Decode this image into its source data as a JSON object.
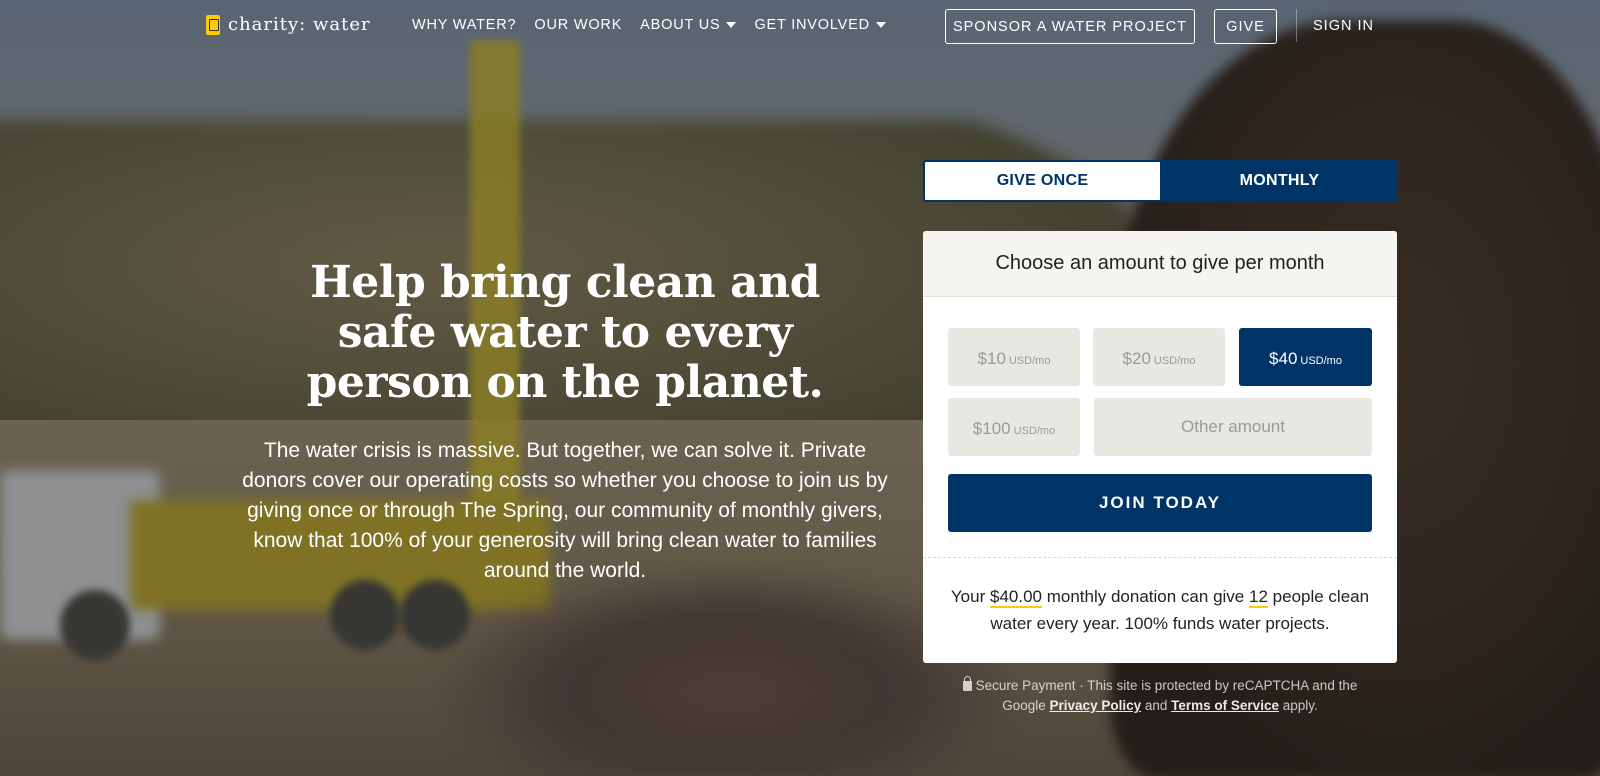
{
  "brand": {
    "name": "charity: water",
    "accent": "#ffc907",
    "navy": "#003366"
  },
  "nav": {
    "items": [
      {
        "label": "WHY WATER?",
        "dropdown": false
      },
      {
        "label": "OUR WORK",
        "dropdown": false
      },
      {
        "label": "ABOUT US",
        "dropdown": true
      },
      {
        "label": "GET INVOLVED",
        "dropdown": true
      }
    ],
    "sponsor_label": "SPONSOR A WATER PROJECT",
    "give_label": "GIVE",
    "signin_label": "SIGN IN"
  },
  "hero": {
    "headline": "Help bring clean and safe water to every person on the planet.",
    "body": "The water crisis is massive. But together, we can solve it. Private donors cover our operating costs so whether you choose to join us by giving once or through The Spring, our community of monthly givers, know that 100% of your generosity will bring clean water to families around the world."
  },
  "donation": {
    "tabs": {
      "once": "GIVE ONCE",
      "monthly": "MONTHLY",
      "active": "monthly"
    },
    "heading": "Choose an amount to give per month",
    "amounts": [
      {
        "value": "$10",
        "unit": "USD/mo",
        "selected": false
      },
      {
        "value": "$20",
        "unit": "USD/mo",
        "selected": false
      },
      {
        "value": "$40",
        "unit": "USD/mo",
        "selected": true
      },
      {
        "value": "$100",
        "unit": "USD/mo",
        "selected": false
      }
    ],
    "other_placeholder": "Other amount",
    "join_label": "JOIN TODAY",
    "impact": {
      "prefix": "Your",
      "amount": "$40.00",
      "middle": "monthly donation can give",
      "people": "12",
      "suffix": "people clean water every year. 100% funds water projects."
    }
  },
  "legal": {
    "secure": "Secure Payment",
    "recaptcha": "· This site is protected by reCAPTCHA and the Google",
    "privacy": "Privacy Policy",
    "and": "and",
    "terms": "Terms of Service",
    "applies": "apply."
  }
}
